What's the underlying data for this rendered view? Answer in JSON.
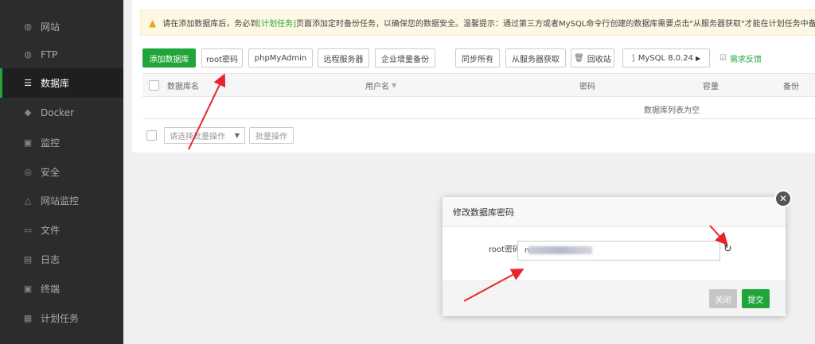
{
  "sidebar": {
    "items": [
      {
        "label": "网站",
        "icon": "globe-icon",
        "glyph": "◍"
      },
      {
        "label": "FTP",
        "icon": "ftp-icon",
        "glyph": "◍"
      },
      {
        "label": "数据库",
        "icon": "database-icon",
        "glyph": "☰",
        "active": true
      },
      {
        "label": "Docker",
        "icon": "docker-icon",
        "glyph": "◆"
      },
      {
        "label": "监控",
        "icon": "monitor-icon",
        "glyph": "▣"
      },
      {
        "label": "安全",
        "icon": "shield-icon",
        "glyph": "◎"
      },
      {
        "label": "网站监控",
        "icon": "site-monitor-icon",
        "glyph": "△"
      },
      {
        "label": "文件",
        "icon": "folder-icon",
        "glyph": "▭"
      },
      {
        "label": "日志",
        "icon": "log-icon",
        "glyph": "▤"
      },
      {
        "label": "终端",
        "icon": "terminal-icon",
        "glyph": "▣"
      },
      {
        "label": "计划任务",
        "icon": "schedule-icon",
        "glyph": "▦"
      }
    ]
  },
  "alert": {
    "prefix": "请在添加数据库后，务必到",
    "link": "[计划任务]",
    "suffix": "页面添加定时备份任务，以确保您的数据安全。温馨提示：通过第三方或者MySQL命令行创建的数据库需要点击\"从服务器获取\"才能在计划任务中备份"
  },
  "toolbar": {
    "add_db": "添加数据库",
    "root_password": "root密码",
    "phpmyadmin": "phpMyAdmin",
    "remote_server": "远程服务器",
    "enterprise_backup": "企业增量备份",
    "sync_all": "同步所有",
    "fetch_from_server": "从服务器获取",
    "recycle_bin": "回收站",
    "mysql_version": "MySQL 8.0.24",
    "feedback": "需求反馈"
  },
  "table": {
    "headers": {
      "name": "数据库名",
      "username": "用户名",
      "password": "密码",
      "capacity": "容量",
      "backup": "备份"
    },
    "empty_text": "数据库列表为空"
  },
  "batch": {
    "select_placeholder": "请选择批量操作",
    "action_button": "批量操作"
  },
  "dialog": {
    "title": "修改数据库密码",
    "label": "root密码",
    "value_prefix": "n",
    "cancel": "关闭",
    "submit": "提交"
  },
  "colors": {
    "accent": "#20a53a",
    "sidebar_bg": "#2b2c2d",
    "annotation_red": "#e8242b"
  }
}
